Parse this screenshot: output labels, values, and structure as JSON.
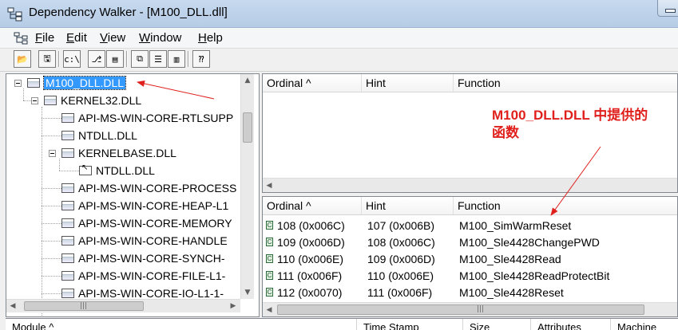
{
  "window": {
    "title": "Dependency Walker - [M100_DLL.dll]"
  },
  "menu": {
    "items": [
      "File",
      "Edit",
      "View",
      "Window",
      "Help"
    ]
  },
  "toolbar": {
    "buttons": [
      {
        "name": "open-icon",
        "glyph": "📂"
      },
      {
        "name": "save-icon",
        "glyph": "🖫"
      },
      {
        "name": "full-paths-icon",
        "glyph": "c:\\"
      },
      {
        "name": "undecorate-icon",
        "glyph": "⎇"
      },
      {
        "name": "properties-icon",
        "glyph": "▤"
      },
      {
        "name": "cascade-icon",
        "glyph": "⧉"
      },
      {
        "name": "tile-horizontal-icon",
        "glyph": "☰"
      },
      {
        "name": "tile-vertical-icon",
        "glyph": "▥"
      },
      {
        "name": "context-help-icon",
        "glyph": "⁇"
      }
    ]
  },
  "tree": {
    "items": [
      {
        "label": "M100_DLL.DLL",
        "depth": 0,
        "expanded": true,
        "selected": true
      },
      {
        "label": "KERNEL32.DLL",
        "depth": 1,
        "expanded": true
      },
      {
        "label": "API-MS-WIN-CORE-RTLSUPP",
        "depth": 2
      },
      {
        "label": "NTDLL.DLL",
        "depth": 2
      },
      {
        "label": "KERNELBASE.DLL",
        "depth": 2,
        "expanded": true
      },
      {
        "label": "NTDLL.DLL",
        "depth": 3,
        "duplicate": true
      },
      {
        "label": "API-MS-WIN-CORE-PROCESS",
        "depth": 2
      },
      {
        "label": "API-MS-WIN-CORE-HEAP-L1",
        "depth": 2
      },
      {
        "label": "API-MS-WIN-CORE-MEMORY",
        "depth": 2
      },
      {
        "label": "API-MS-WIN-CORE-HANDLE",
        "depth": 2
      },
      {
        "label": "API-MS-WIN-CORE-SYNCH-",
        "depth": 2
      },
      {
        "label": "API-MS-WIN-CORE-FILE-L1-",
        "depth": 2
      },
      {
        "label": "API-MS-WIN-CORE-IO-L1-1-",
        "depth": 2
      }
    ]
  },
  "imports": {
    "columns": [
      "Ordinal ^",
      "Hint",
      "Function"
    ],
    "rows": []
  },
  "exports": {
    "columns": [
      "Ordinal ^",
      "Hint",
      "Function"
    ],
    "rows": [
      {
        "ordinal": "108  (0x006C)",
        "hint": "107  (0x006B)",
        "function": "M100_SimWarmReset"
      },
      {
        "ordinal": "109  (0x006D)",
        "hint": "108  (0x006C)",
        "function": "M100_Sle4428ChangePWD"
      },
      {
        "ordinal": "110  (0x006E)",
        "hint": "109  (0x006D)",
        "function": "M100_Sle4428Read"
      },
      {
        "ordinal": "111  (0x006F)",
        "hint": "110  (0x006E)",
        "function": "M100_Sle4428ReadProtectBit"
      },
      {
        "ordinal": "112  (0x0070)",
        "hint": "111  (0x006F)",
        "function": "M100_Sle4428Reset"
      }
    ]
  },
  "modules": {
    "columns": [
      "Module ^",
      "Time Stamp",
      "Size",
      "Attributes",
      "Machine"
    ]
  },
  "annotation": {
    "text": "M100_DLL.DLL 中提供的函数",
    "color": "#e0201c"
  },
  "colors": {
    "selection": "#3399ff",
    "annotation": "#e0201c"
  }
}
